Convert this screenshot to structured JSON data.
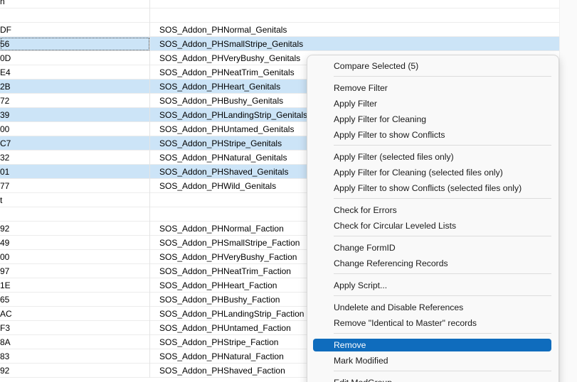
{
  "rows": [
    {
      "id": "n",
      "name": "",
      "selected": false
    },
    {
      "id": "",
      "name": "",
      "selected": false
    },
    {
      "id": "DF",
      "name": "SOS_Addon_PHNormal_Genitals",
      "selected": false
    },
    {
      "id": "56",
      "name": "SOS_Addon_PHSmallStripe_Genitals",
      "selected": true
    },
    {
      "id": "0D",
      "name": "SOS_Addon_PHVeryBushy_Genitals",
      "selected": false
    },
    {
      "id": "E4",
      "name": "SOS_Addon_PHNeatTrim_Genitals",
      "selected": false
    },
    {
      "id": "2B",
      "name": "SOS_Addon_PHHeart_Genitals",
      "selected": true
    },
    {
      "id": "72",
      "name": "SOS_Addon_PHBushy_Genitals",
      "selected": false
    },
    {
      "id": "39",
      "name": "SOS_Addon_PHLandingStrip_Genitals",
      "selected": true
    },
    {
      "id": "00",
      "name": "SOS_Addon_PHUntamed_Genitals",
      "selected": false
    },
    {
      "id": "C7",
      "name": "SOS_Addon_PHStripe_Genitals",
      "selected": true
    },
    {
      "id": "32",
      "name": "SOS_Addon_PHNatural_Genitals",
      "selected": false
    },
    {
      "id": "01",
      "name": "SOS_Addon_PHShaved_Genitals",
      "selected": true
    },
    {
      "id": "77",
      "name": "SOS_Addon_PHWild_Genitals",
      "selected": false
    },
    {
      "id": "t",
      "name": "",
      "selected": false
    },
    {
      "id": "",
      "name": "",
      "selected": false
    },
    {
      "id": "92",
      "name": "SOS_Addon_PHNormal_Faction",
      "selected": false
    },
    {
      "id": "49",
      "name": "SOS_Addon_PHSmallStripe_Faction",
      "selected": false
    },
    {
      "id": "00",
      "name": "SOS_Addon_PHVeryBushy_Faction",
      "selected": false
    },
    {
      "id": "97",
      "name": "SOS_Addon_PHNeatTrim_Faction",
      "selected": false
    },
    {
      "id": "1E",
      "name": "SOS_Addon_PHHeart_Faction",
      "selected": false
    },
    {
      "id": "65",
      "name": "SOS_Addon_PHBushy_Faction",
      "selected": false
    },
    {
      "id": "AC",
      "name": "SOS_Addon_PHLandingStrip_Faction",
      "selected": false
    },
    {
      "id": "F3",
      "name": "SOS_Addon_PHUntamed_Faction",
      "selected": false
    },
    {
      "id": "8A",
      "name": "SOS_Addon_PHStripe_Faction",
      "selected": false
    },
    {
      "id": "83",
      "name": "SOS_Addon_PHNatural_Faction",
      "selected": false
    },
    {
      "id": "92",
      "name": "SOS_Addon_PHShaved_Faction",
      "selected": false
    }
  ],
  "context_menu": {
    "items": [
      {
        "label": "Compare Selected (5)",
        "name": "menu-compare-selected"
      },
      {
        "sep": true
      },
      {
        "label": "Remove Filter",
        "name": "menu-remove-filter"
      },
      {
        "label": "Apply Filter",
        "name": "menu-apply-filter"
      },
      {
        "label": "Apply Filter for Cleaning",
        "name": "menu-apply-filter-cleaning"
      },
      {
        "label": "Apply Filter to show Conflicts",
        "name": "menu-apply-filter-conflicts"
      },
      {
        "sep": true
      },
      {
        "label": "Apply Filter (selected files only)",
        "name": "menu-apply-filter-selected"
      },
      {
        "label": "Apply Filter for Cleaning (selected files only)",
        "name": "menu-apply-filter-cleaning-selected"
      },
      {
        "label": "Apply Filter to show Conflicts (selected files only)",
        "name": "menu-apply-filter-conflicts-selected"
      },
      {
        "sep": true
      },
      {
        "label": "Check for Errors",
        "name": "menu-check-errors"
      },
      {
        "label": "Check for Circular Leveled Lists",
        "name": "menu-check-circular-leveled-lists"
      },
      {
        "sep": true
      },
      {
        "label": "Change FormID",
        "name": "menu-change-formid"
      },
      {
        "label": "Change Referencing Records",
        "name": "menu-change-referencing-records"
      },
      {
        "sep": true
      },
      {
        "label": "Apply Script...",
        "name": "menu-apply-script"
      },
      {
        "sep": true
      },
      {
        "label": "Undelete and Disable References",
        "name": "menu-undelete-disable-references"
      },
      {
        "label": "Remove \"Identical to Master\" records",
        "name": "menu-remove-itm-records"
      },
      {
        "sep": true
      },
      {
        "label": "Remove",
        "name": "menu-remove",
        "active": true
      },
      {
        "label": "Mark Modified",
        "name": "menu-mark-modified"
      },
      {
        "sep": true
      },
      {
        "label": "Edit ModGroup",
        "name": "menu-edit-modgroup"
      }
    ]
  },
  "colors": {
    "selection": "#cce4f7",
    "menu_highlight": "#0f6cbd",
    "menu_background": "#f9f9f9"
  }
}
